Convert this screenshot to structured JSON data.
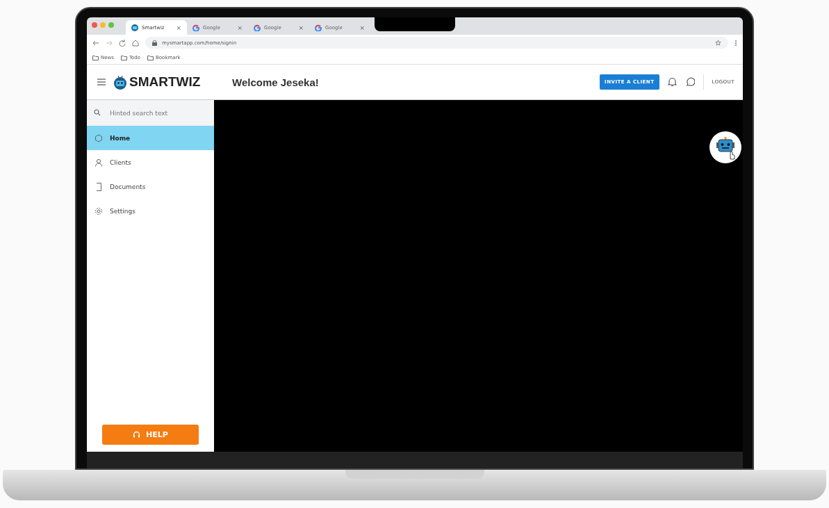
{
  "browser": {
    "tabs": [
      {
        "title": "Smartwiz",
        "selected": true,
        "close": "×"
      },
      {
        "title": "Google",
        "selected": false,
        "close": "×"
      },
      {
        "title": "Google",
        "selected": false,
        "close": "×"
      },
      {
        "title": "Google",
        "selected": false,
        "close": "×"
      }
    ],
    "url": "mysmartapp.com/home/signin",
    "bookmarks": [
      "News",
      "Todo",
      "Bookmark"
    ]
  },
  "header": {
    "logo": "SMARTWIZ",
    "welcome": "Welcome Jeseka!",
    "invite_button": "INVITE A CLIENT",
    "logout": "LOGOUT"
  },
  "sidebar": {
    "search": {
      "placeholder": "Hinted search text"
    },
    "items": [
      {
        "label": "Home",
        "kind": "home",
        "selected": true
      },
      {
        "label": "Clients",
        "kind": "person",
        "selected": false
      },
      {
        "label": "Documents",
        "kind": "document",
        "selected": false
      },
      {
        "label": "Settings",
        "kind": "gear",
        "selected": false
      }
    ],
    "help_button": "HELP"
  }
}
